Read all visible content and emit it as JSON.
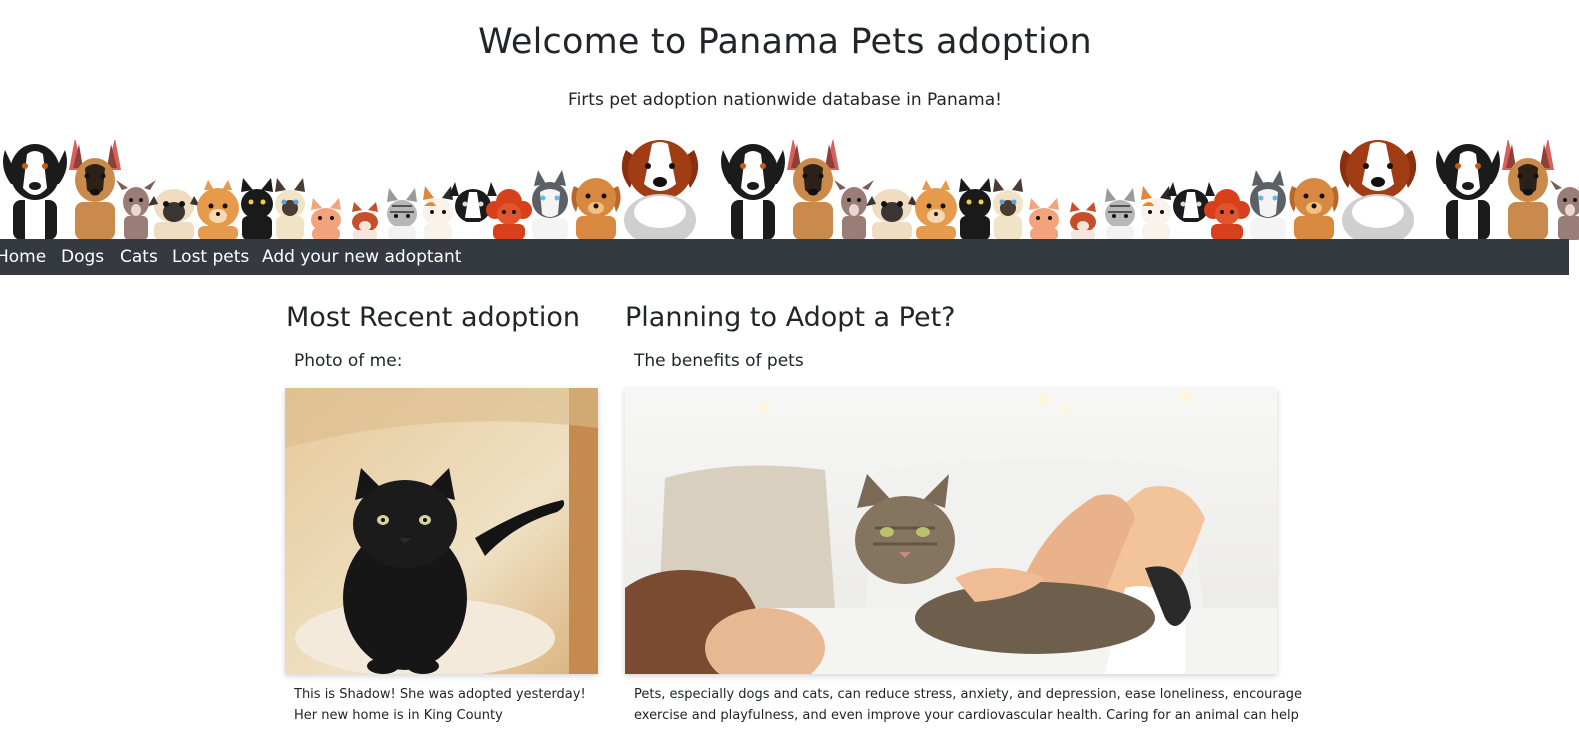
{
  "header": {
    "title": "Welcome to Panama Pets adoption",
    "subtitle": "Firts pet adoption nationwide database in Panama!"
  },
  "nav": {
    "items": [
      {
        "label": "Home"
      },
      {
        "label": "Dogs"
      },
      {
        "label": "Cats"
      },
      {
        "label": "Lost pets"
      },
      {
        "label": "Add your new adoptant"
      }
    ]
  },
  "recent": {
    "heading": "Most Recent adoption",
    "subheading": "Photo of me:",
    "caption_line1": "This is Shadow! She was adopted yesterday!",
    "caption_line2": "Her new home is in King County"
  },
  "planning": {
    "heading": "Planning to Adopt a Pet?",
    "subheading": "The benefits of pets",
    "text_line1": "Pets, especially dogs and cats, can reduce stress, anxiety, and depression, ease loneliness, encourage",
    "text_line2": "exercise and playfulness, and even improve your cardiovascular health. Caring for an animal can help"
  },
  "colors": {
    "navbar": "#343a40",
    "text": "#212529"
  }
}
